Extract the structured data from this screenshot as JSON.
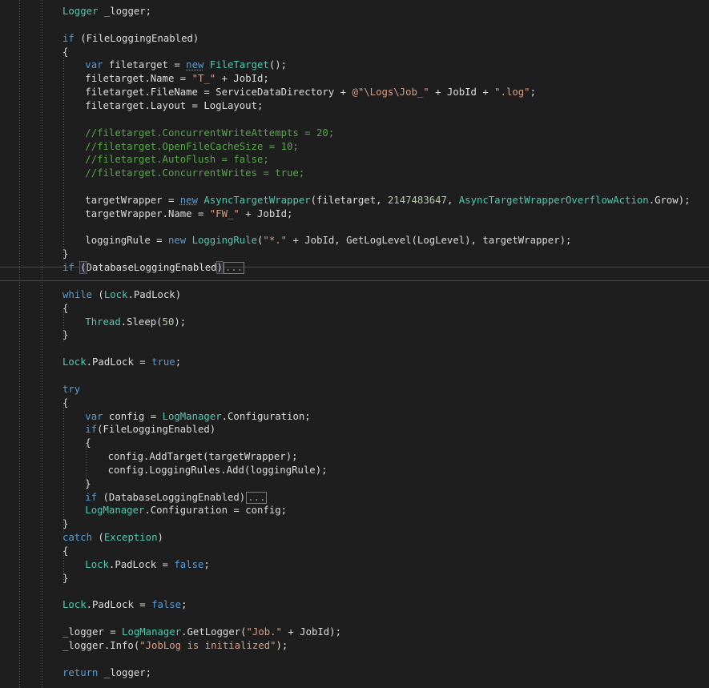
{
  "editor": {
    "collapsed_marker": "...",
    "lines": [
      {
        "indent": 1,
        "tokens": [
          {
            "t": "Logger",
            "c": "ty"
          },
          {
            "t": " _logger;",
            "c": "vb"
          }
        ]
      },
      {
        "indent": 1,
        "tokens": []
      },
      {
        "indent": 1,
        "tokens": [
          {
            "t": "if",
            "c": "kw"
          },
          {
            "t": " (FileLoggingEnabled)",
            "c": "vb"
          }
        ]
      },
      {
        "indent": 1,
        "tokens": [
          {
            "t": "{",
            "c": "vb"
          }
        ]
      },
      {
        "indent": 2,
        "tokens": [
          {
            "t": "var",
            "c": "kw"
          },
          {
            "t": " filetarget = ",
            "c": "vb"
          },
          {
            "t": "new",
            "c": "kw",
            "squiggle": true
          },
          {
            "t": " ",
            "c": "vb"
          },
          {
            "t": "FileTarget",
            "c": "ty"
          },
          {
            "t": "();",
            "c": "vb"
          }
        ]
      },
      {
        "indent": 2,
        "tokens": [
          {
            "t": "filetarget.Name = ",
            "c": "vb"
          },
          {
            "t": "\"T_\"",
            "c": "str"
          },
          {
            "t": " + JobId;",
            "c": "vb"
          }
        ]
      },
      {
        "indent": 2,
        "tokens": [
          {
            "t": "filetarget.FileName = ServiceDataDirectory + ",
            "c": "vb"
          },
          {
            "t": "@\"\\Logs\\Job_\"",
            "c": "str"
          },
          {
            "t": " + JobId + ",
            "c": "vb"
          },
          {
            "t": "\".log\"",
            "c": "str"
          },
          {
            "t": ";",
            "c": "vb"
          }
        ]
      },
      {
        "indent": 2,
        "tokens": [
          {
            "t": "filetarget.Layout = LogLayout;",
            "c": "vb"
          }
        ]
      },
      {
        "indent": 2,
        "tokens": []
      },
      {
        "indent": 2,
        "tokens": [
          {
            "t": "//filetarget.ConcurrentWriteAttempts = 20;",
            "c": "cm"
          }
        ]
      },
      {
        "indent": 2,
        "tokens": [
          {
            "t": "//filetarget.OpenFileCacheSize = 10;",
            "c": "cm"
          }
        ]
      },
      {
        "indent": 2,
        "tokens": [
          {
            "t": "//filetarget.AutoFlush = false;",
            "c": "cm"
          }
        ]
      },
      {
        "indent": 2,
        "tokens": [
          {
            "t": "//filetarget.ConcurrentWrites = true;",
            "c": "cm"
          }
        ]
      },
      {
        "indent": 2,
        "tokens": []
      },
      {
        "indent": 2,
        "tokens": [
          {
            "t": "targetWrapper = ",
            "c": "vb"
          },
          {
            "t": "new",
            "c": "kw",
            "squiggle": true
          },
          {
            "t": " ",
            "c": "vb"
          },
          {
            "t": "AsyncTargetWrapper",
            "c": "ty"
          },
          {
            "t": "(filetarget, ",
            "c": "vb"
          },
          {
            "t": "2147483647",
            "c": "num"
          },
          {
            "t": ", ",
            "c": "vb"
          },
          {
            "t": "AsyncTargetWrapperOverflowAction",
            "c": "ty"
          },
          {
            "t": ".Grow);",
            "c": "vb"
          }
        ]
      },
      {
        "indent": 2,
        "tokens": [
          {
            "t": "targetWrapper.Name = ",
            "c": "vb"
          },
          {
            "t": "\"FW_\"",
            "c": "str"
          },
          {
            "t": " + JobId;",
            "c": "vb"
          }
        ]
      },
      {
        "indent": 2,
        "tokens": []
      },
      {
        "indent": 2,
        "tokens": [
          {
            "t": "loggingRule = ",
            "c": "vb"
          },
          {
            "t": "new",
            "c": "kw"
          },
          {
            "t": " ",
            "c": "vb"
          },
          {
            "t": "LoggingRule",
            "c": "ty"
          },
          {
            "t": "(",
            "c": "vb"
          },
          {
            "t": "\"*.\"",
            "c": "str"
          },
          {
            "t": " + JobId, GetLogLevel(LogLevel), targetWrapper);",
            "c": "vb"
          }
        ]
      },
      {
        "indent": 1,
        "tokens": [
          {
            "t": "}",
            "c": "vb"
          }
        ]
      },
      {
        "indent": 1,
        "current": true,
        "tokens": [
          {
            "t": "if",
            "c": "kw"
          },
          {
            "t": " ",
            "c": "vb"
          },
          {
            "t": "(",
            "c": "vb",
            "match": true
          },
          {
            "t": "DatabaseLoggingEnabled",
            "c": "vb"
          },
          {
            "t": ")",
            "c": "vb",
            "match": true
          },
          {
            "collapsed": true
          }
        ]
      },
      {
        "indent": 1,
        "tokens": []
      },
      {
        "indent": 1,
        "tokens": [
          {
            "t": "while",
            "c": "kw"
          },
          {
            "t": " (",
            "c": "vb"
          },
          {
            "t": "Lock",
            "c": "ty"
          },
          {
            "t": ".PadLock)",
            "c": "vb"
          }
        ]
      },
      {
        "indent": 1,
        "tokens": [
          {
            "t": "{",
            "c": "vb"
          }
        ]
      },
      {
        "indent": 2,
        "tokens": [
          {
            "t": "Thread",
            "c": "ty"
          },
          {
            "t": ".Sleep(",
            "c": "vb"
          },
          {
            "t": "50",
            "c": "num"
          },
          {
            "t": ");",
            "c": "vb"
          }
        ]
      },
      {
        "indent": 1,
        "tokens": [
          {
            "t": "}",
            "c": "vb"
          }
        ]
      },
      {
        "indent": 1,
        "tokens": []
      },
      {
        "indent": 1,
        "tokens": [
          {
            "t": "Lock",
            "c": "ty"
          },
          {
            "t": ".PadLock = ",
            "c": "vb"
          },
          {
            "t": "true",
            "c": "kw"
          },
          {
            "t": ";",
            "c": "vb"
          }
        ]
      },
      {
        "indent": 1,
        "tokens": []
      },
      {
        "indent": 1,
        "tokens": [
          {
            "t": "try",
            "c": "kw"
          }
        ]
      },
      {
        "indent": 1,
        "tokens": [
          {
            "t": "{",
            "c": "vb"
          }
        ]
      },
      {
        "indent": 2,
        "tokens": [
          {
            "t": "var",
            "c": "kw"
          },
          {
            "t": " config = ",
            "c": "vb"
          },
          {
            "t": "LogManager",
            "c": "ty"
          },
          {
            "t": ".Configuration;",
            "c": "vb"
          }
        ]
      },
      {
        "indent": 2,
        "tokens": [
          {
            "t": "if",
            "c": "kw"
          },
          {
            "t": "(FileLoggingEnabled)",
            "c": "vb"
          }
        ]
      },
      {
        "indent": 2,
        "tokens": [
          {
            "t": "{",
            "c": "vb"
          }
        ]
      },
      {
        "indent": 3,
        "tokens": [
          {
            "t": "config.AddTarget(targetWrapper);",
            "c": "vb"
          }
        ]
      },
      {
        "indent": 3,
        "tokens": [
          {
            "t": "config.LoggingRules.Add(loggingRule);",
            "c": "vb"
          }
        ]
      },
      {
        "indent": 2,
        "tokens": [
          {
            "t": "}",
            "c": "vb"
          }
        ]
      },
      {
        "indent": 2,
        "tokens": [
          {
            "t": "if",
            "c": "kw"
          },
          {
            "t": " (DatabaseLoggingEnabled)",
            "c": "vb"
          },
          {
            "collapsed": true
          }
        ]
      },
      {
        "indent": 2,
        "tokens": [
          {
            "t": "LogManager",
            "c": "ty"
          },
          {
            "t": ".Configuration = config;",
            "c": "vb"
          }
        ]
      },
      {
        "indent": 1,
        "tokens": [
          {
            "t": "}",
            "c": "vb"
          }
        ]
      },
      {
        "indent": 1,
        "tokens": [
          {
            "t": "catch",
            "c": "kw"
          },
          {
            "t": " (",
            "c": "vb"
          },
          {
            "t": "Exception",
            "c": "ty"
          },
          {
            "t": ")",
            "c": "vb"
          }
        ]
      },
      {
        "indent": 1,
        "tokens": [
          {
            "t": "{",
            "c": "vb"
          }
        ]
      },
      {
        "indent": 2,
        "tokens": [
          {
            "t": "Lock",
            "c": "ty"
          },
          {
            "t": ".PadLock = ",
            "c": "vb"
          },
          {
            "t": "false",
            "c": "kw"
          },
          {
            "t": ";",
            "c": "vb"
          }
        ]
      },
      {
        "indent": 1,
        "tokens": [
          {
            "t": "}",
            "c": "vb"
          }
        ]
      },
      {
        "indent": 1,
        "tokens": []
      },
      {
        "indent": 1,
        "tokens": [
          {
            "t": "Lock",
            "c": "ty"
          },
          {
            "t": ".PadLock = ",
            "c": "vb"
          },
          {
            "t": "false",
            "c": "kw"
          },
          {
            "t": ";",
            "c": "vb"
          }
        ]
      },
      {
        "indent": 1,
        "tokens": []
      },
      {
        "indent": 1,
        "tokens": [
          {
            "t": "_logger = ",
            "c": "vb"
          },
          {
            "t": "LogManager",
            "c": "ty"
          },
          {
            "t": ".GetLogger(",
            "c": "vb"
          },
          {
            "t": "\"Job.\"",
            "c": "str"
          },
          {
            "t": " + JobId);",
            "c": "vb"
          }
        ]
      },
      {
        "indent": 1,
        "tokens": [
          {
            "t": "_logger.Info(",
            "c": "vb"
          },
          {
            "t": "\"JobLog is initialized\"",
            "c": "str"
          },
          {
            "t": ");",
            "c": "vb"
          }
        ]
      },
      {
        "indent": 1,
        "tokens": []
      },
      {
        "indent": 1,
        "tokens": [
          {
            "t": "return",
            "c": "kw"
          },
          {
            "t": " _logger;",
            "c": "vb"
          }
        ]
      }
    ]
  }
}
